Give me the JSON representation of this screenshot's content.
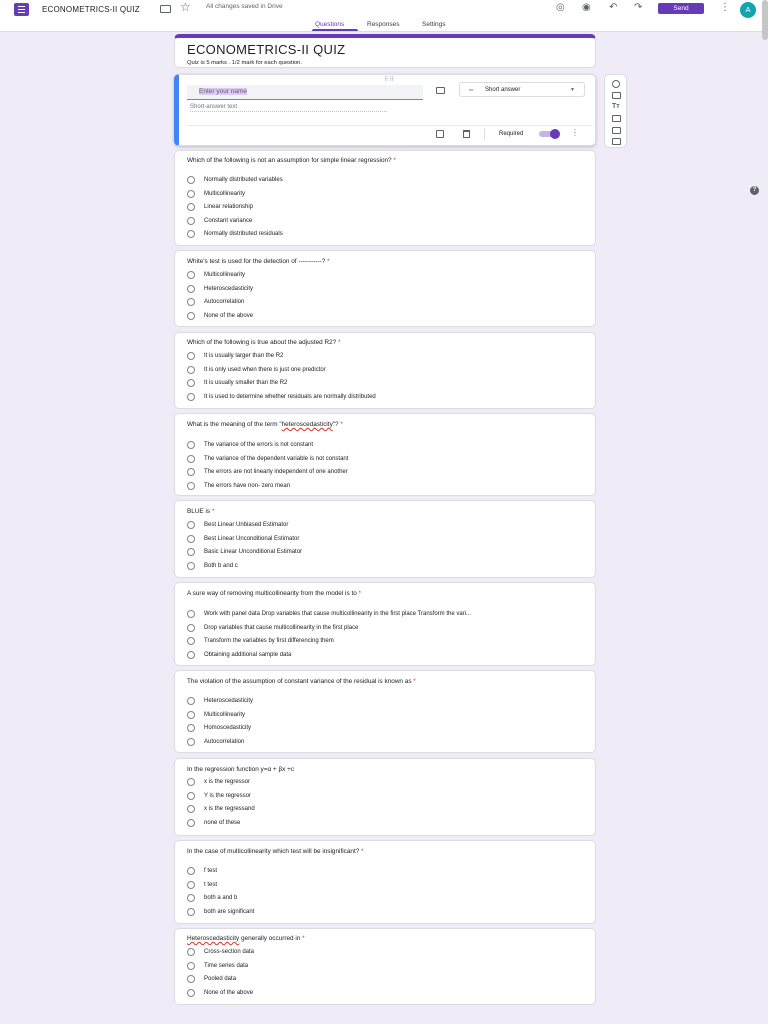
{
  "topbar": {
    "title": "ECONOMETRICS-II QUIZ",
    "saved_status": "All changes saved in Drive",
    "send_label": "Send",
    "avatar_letter": "A",
    "icons": [
      "palette-icon",
      "preview-eye-icon",
      "undo-icon",
      "redo-icon",
      "more-vert-icon"
    ]
  },
  "tabs": [
    {
      "label": "Questions",
      "active": true
    },
    {
      "label": "Responses",
      "active": false
    },
    {
      "label": "Settings",
      "active": false
    }
  ],
  "form": {
    "title": "ECONOMETRICS-II QUIZ",
    "description": "Quiz is 5 marks . 1/2 mark for each question."
  },
  "active_question": {
    "title_text": "Enter your name",
    "type": "Short answer",
    "placeholder": "Short-answer text",
    "required_label": "Required",
    "required": true
  },
  "questions": [
    {
      "title": "Which of the following is not an assumption for simple linear regression?",
      "required": true,
      "options": [
        "Normally distributed variables",
        "Multicollinearity",
        "Linear relationship",
        "Constant variance",
        "Normally distributed residuals"
      ]
    },
    {
      "title": "White's test is used for the detection of -----------?",
      "required": true,
      "options": [
        "Multicollinearity",
        "Heteroscedasticity",
        "Autocorrelation",
        "None of the above"
      ]
    },
    {
      "title": "Which of the following is true about the adjusted R2?",
      "required": true,
      "options": [
        "It is usually larger than the R2",
        "It is only used when there is just one predictor",
        "It is usually smaller than the R2",
        "It is used to determine whether residuals are normally distributed"
      ]
    },
    {
      "title_pre": "What is the meaning of the term \"",
      "title_underlined": "heteroscedasticity",
      "title_post": "\"?",
      "required": true,
      "options": [
        "The variance of the errors is not constant",
        "The variance of the dependent variable is not constant",
        "The errors are not linearly independent of one another",
        "The errors have non- zero mean"
      ]
    },
    {
      "title": "BLUE is",
      "required": true,
      "options": [
        "Best Linear Unbiased Estimator",
        "Best Linear Unconditional Estimator",
        "Basic Linear Unconditional Estimator",
        "Both b and c"
      ]
    },
    {
      "title": "A sure way of removing multicollinearity from the model is to",
      "required": true,
      "options": [
        "Work with panel data Drop variables that cause multicollinearity in the first place Transform the vari...",
        "Drop variables that cause multicollinearity in the first place",
        "Transform the variables by first differencing them",
        "Obtaining additional sample data"
      ]
    },
    {
      "title": "The violation of the assumption of constant variance of the residual is known as",
      "required": true,
      "options": [
        "Heteroscedasticity",
        "Multicollinearity",
        "Homoscedasticity",
        "Autocorrelation"
      ]
    },
    {
      "title": "In the regression function y=α + βx +c",
      "required": false,
      "options": [
        "x is the regressor",
        "Y is the regressor",
        "x is the regressand",
        "none of these"
      ]
    },
    {
      "title": "In the case of multicollinearity which test will be insignificant?",
      "required": true,
      "options": [
        "f test",
        "t test",
        "both a and b",
        "both are significant"
      ]
    },
    {
      "title_underlined": "Heteroscedasticity",
      "title_post": " generally occurred in",
      "required": true,
      "options": [
        "Cross-section data",
        "Time series data",
        "Pooled data",
        "None of the above"
      ]
    }
  ],
  "side_toolbar": [
    "add-question-icon",
    "import-questions-icon",
    "add-title-icon",
    "add-image-icon",
    "add-video-icon",
    "add-section-icon"
  ],
  "colors": {
    "accent": "#673ab7",
    "focus": "#4285f4",
    "background": "#efebf7",
    "required": "#d93025"
  }
}
